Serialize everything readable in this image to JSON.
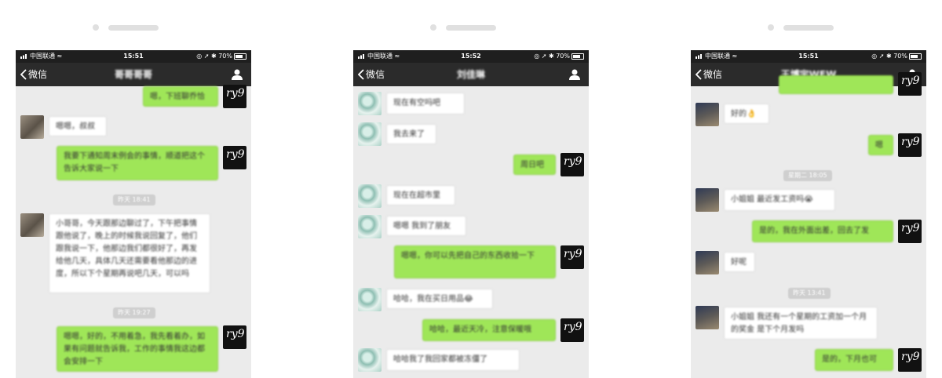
{
  "panels": [
    {
      "status": {
        "carrier": "中国联通",
        "time": "15:51",
        "battery": "70%"
      },
      "nav": {
        "back_label": "微信",
        "title": "哥哥哥哥"
      },
      "messages": [
        {
          "from": "me",
          "text": "嗯，下班聊乔恰"
        },
        {
          "from": "them",
          "text": "嗯嗯，叔叔"
        },
        {
          "from": "me",
          "text": "我要下通知周末例会的事情，顺道把这个告诉大家说一下"
        },
        {
          "from": "time",
          "text": "昨天 18:41"
        },
        {
          "from": "them",
          "text": "小哥哥，今天跟那边聊过了，下午把事情跟他说了，晚上的时候我说回复了，他们跟我说一下，他那边我们都很好了，再发给他几天，具体几天还需要看他那边的进度，所以下个星期再说吧几天，可以吗"
        },
        {
          "from": "time",
          "text": "昨天 19:27"
        },
        {
          "from": "me",
          "text": "嗯嗯，好的，不用着急，我先看着办，如果有问题就告诉我，工作的事情我这边都会安排一下"
        }
      ]
    },
    {
      "status": {
        "carrier": "中国联通",
        "time": "15:52",
        "battery": "70%"
      },
      "nav": {
        "back_label": "微信",
        "title": "刘佳琳"
      },
      "messages": [
        {
          "from": "them",
          "text": "现在有空吗吧"
        },
        {
          "from": "them",
          "text": "我去来了"
        },
        {
          "from": "me",
          "text": "周日吧"
        },
        {
          "from": "them",
          "text": "现在在超市里"
        },
        {
          "from": "them",
          "text": "嗯嗯 我到了朋友"
        },
        {
          "from": "me",
          "text": "嗯嗯，你可以先把自己的东西收拾一下"
        },
        {
          "from": "them",
          "text": "哈哈，我在买日用品😂"
        },
        {
          "from": "me",
          "text": "哈哈，最近天冷，注意保暖哦"
        },
        {
          "from": "them",
          "text": "哈哈我了我回家都被冻僵了"
        }
      ]
    },
    {
      "status": {
        "carrier": "中国联通",
        "time": "15:51",
        "battery": "70%"
      },
      "nav": {
        "back_label": "微信",
        "title": "王博宇WEW"
      },
      "messages": [
        {
          "from": "me",
          "text": ""
        },
        {
          "from": "them",
          "text": "好的👌"
        },
        {
          "from": "me",
          "text": "嗯"
        },
        {
          "from": "time",
          "text": "星期二 18:05"
        },
        {
          "from": "them",
          "text": "小姐姐 最近发工资吗😭"
        },
        {
          "from": "me",
          "text": "是的，我在外面出差，回去了发"
        },
        {
          "from": "them",
          "text": "好呢"
        },
        {
          "from": "time",
          "text": "昨天 13:41"
        },
        {
          "from": "them",
          "text": "小姐姐 我还有一个星期的工资加一个月的奖金 是下个月发吗"
        },
        {
          "from": "me",
          "text": "是的，下月也可"
        }
      ]
    }
  ]
}
